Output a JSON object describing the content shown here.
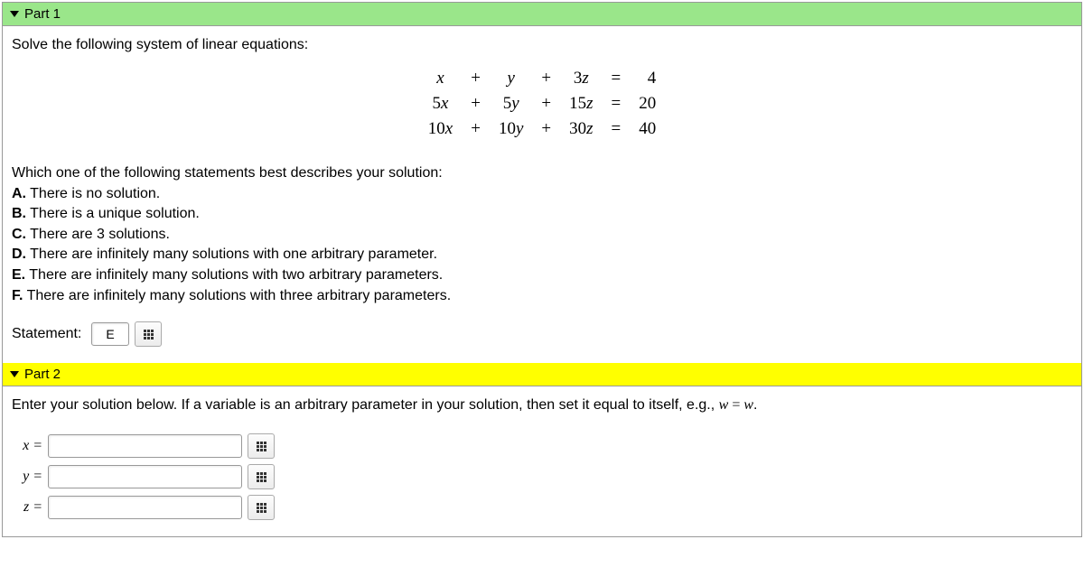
{
  "part1": {
    "title": "Part 1",
    "prompt": "Solve the following system of linear equations:",
    "equations": {
      "rows": [
        {
          "xcoef": "",
          "xvar": "x",
          "op1": "+",
          "ycoef": "",
          "yvar": "y",
          "op2": "+",
          "zcoef": "3",
          "zvar": "z",
          "eq": "=",
          "rhs": "4"
        },
        {
          "xcoef": "5",
          "xvar": "x",
          "op1": "+",
          "ycoef": "5",
          "yvar": "y",
          "op2": "+",
          "zcoef": "15",
          "zvar": "z",
          "eq": "=",
          "rhs": "20"
        },
        {
          "xcoef": "10",
          "xvar": "x",
          "op1": "+",
          "ycoef": "10",
          "yvar": "y",
          "op2": "+",
          "zcoef": "30",
          "zvar": "z",
          "eq": "=",
          "rhs": "40"
        }
      ]
    },
    "question": "Which one of the following statements best describes your solution:",
    "options": {
      "A_label": "A.",
      "A_text": "There is no solution.",
      "B_label": "B.",
      "B_text": "There is a unique solution.",
      "C_label": "C.",
      "C_text": "There are 3 solutions.",
      "D_label": "D.",
      "D_text": "There are infinitely many solutions with one arbitrary parameter.",
      "E_label": "E.",
      "E_text": "There are infinitely many solutions with two arbitrary parameters.",
      "F_label": "F.",
      "F_text": "There are infinitely many solutions with three arbitrary parameters."
    },
    "statement_label": "Statement:",
    "statement_value": "E"
  },
  "part2": {
    "title": "Part 2",
    "instruction_pre": "Enter your solution below. If a variable is an arbitrary parameter in your solution, then set it equal to itself, e.g., ",
    "instruction_math_lhs": "w",
    "instruction_math_eq": " = ",
    "instruction_math_rhs": "w",
    "instruction_post": ".",
    "x_label": "x =",
    "y_label": "y =",
    "z_label": "z =",
    "x_value": "",
    "y_value": "",
    "z_value": ""
  }
}
